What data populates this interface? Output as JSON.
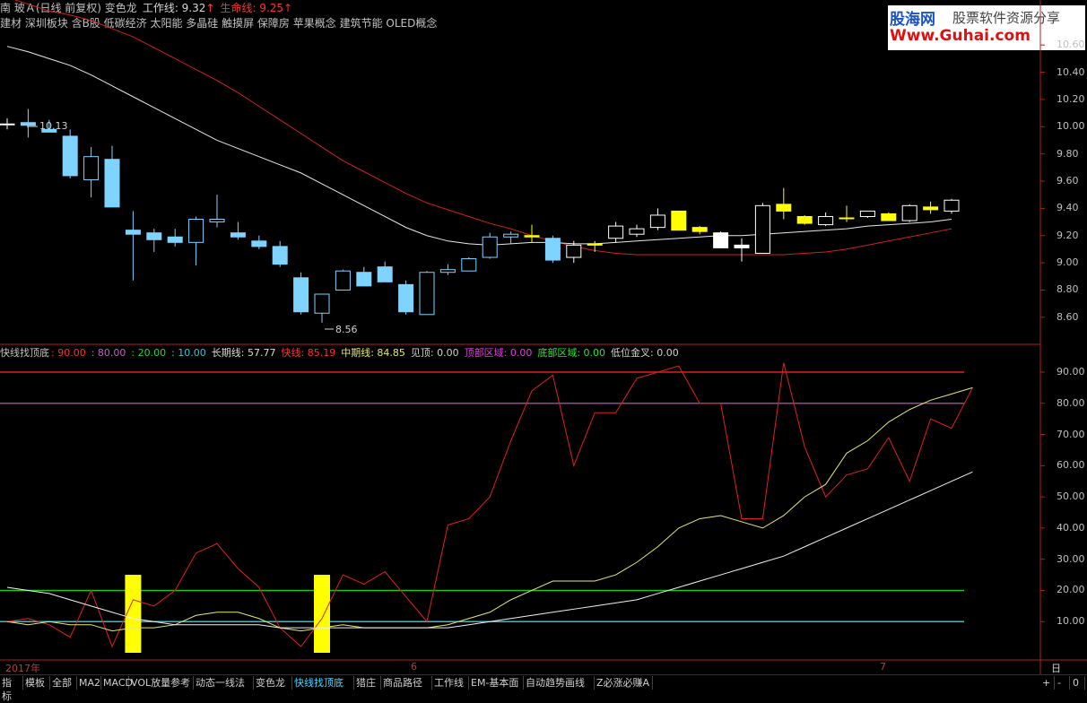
{
  "upper_header": {
    "title": "南 玻Ａ(日线 前复权) 变色龙",
    "work_line_label": "工作线: 9.32",
    "life_line_label": "生命线: 9.25",
    "arrow": "↑",
    "concepts": "建材        深圳板块   含B股 低碳经济 太阳能 多晶硅 触摸屏 保障房 苹果概念 建筑节能 OLED概念"
  },
  "upper_annotations": {
    "high": "10.13",
    "low": "8.56"
  },
  "upper_ticks": [
    "10.60",
    "10.40",
    "10.20",
    "10.00",
    "9.80",
    "9.60",
    "9.40",
    "9.20",
    "9.00",
    "8.80",
    "8.60"
  ],
  "lower_header": {
    "name": "快线找顶底",
    "v1": ": 90.00",
    "v2": ": 80.00",
    "v3": ": 20.00",
    "v4": ": 10.00",
    "long_line": "长期线: 57.77",
    "fast_line": "快线: 85.19",
    "mid_line": "中期线: 84.85",
    "top_see": "见顶: 0.00",
    "top_zone": "顶部区域: 0.00",
    "bottom_zone": "底部区域: 0.00",
    "low_cross": "低位金叉: 0.00"
  },
  "lower_ticks": [
    "90.00",
    "80.00",
    "70.00",
    "60.00",
    "50.00",
    "40.00",
    "30.00",
    "20.00",
    "10.00"
  ],
  "x_axis": {
    "year": "2017年",
    "m6": "6",
    "m7": "7",
    "period": "日线"
  },
  "tabs": [
    "指标",
    "模板",
    "全部",
    "MA2",
    "MACD",
    "VOL放量参考",
    "动态一线法",
    "变色龙",
    "快线找顶底",
    "猎庄",
    "商品路径",
    "工作线",
    "EM-基本面",
    "自动趋势画线",
    "Z必涨必赚A"
  ],
  "active_tab": "快线找顶底",
  "corner": {
    "plus": "+",
    "minus": "-",
    "zero": "0"
  },
  "watermark": {
    "site": "股海网",
    "slogan": "股票软件资源分享",
    "url": "Www.Guhai.com"
  },
  "colors": {
    "up": "#ff4040",
    "down": "#7fd3ff",
    "yellow": "#ffff00",
    "white": "#ffffff",
    "red": "#e02020"
  },
  "chart_data": [
    {
      "type": "candlestick",
      "ylim": [
        8.5,
        10.7
      ],
      "candles": [
        {
          "o": 10.02,
          "h": 10.06,
          "l": 9.98,
          "c": 10.02,
          "color": "cross"
        },
        {
          "o": 10.03,
          "h": 10.13,
          "l": 9.92,
          "c": 10.01,
          "color": "down"
        },
        {
          "o": 9.98,
          "h": 10.05,
          "l": 9.96,
          "c": 9.96,
          "color": "down"
        },
        {
          "o": 9.93,
          "h": 9.98,
          "l": 9.62,
          "c": 9.64,
          "color": "down"
        },
        {
          "o": 9.61,
          "h": 9.85,
          "l": 9.48,
          "c": 9.78,
          "color": "up"
        },
        {
          "o": 9.76,
          "h": 9.86,
          "l": 9.41,
          "c": 9.41,
          "color": "down"
        },
        {
          "o": 9.24,
          "h": 9.38,
          "l": 8.87,
          "c": 9.21,
          "color": "down"
        },
        {
          "o": 9.22,
          "h": 9.25,
          "l": 9.08,
          "c": 9.17,
          "color": "down"
        },
        {
          "o": 9.19,
          "h": 9.25,
          "l": 9.12,
          "c": 9.15,
          "color": "down"
        },
        {
          "o": 9.15,
          "h": 9.34,
          "l": 8.98,
          "c": 9.32,
          "color": "up"
        },
        {
          "o": 9.3,
          "h": 9.5,
          "l": 9.26,
          "c": 9.32,
          "color": "up"
        },
        {
          "o": 9.22,
          "h": 9.3,
          "l": 9.17,
          "c": 9.19,
          "color": "down"
        },
        {
          "o": 9.16,
          "h": 9.2,
          "l": 9.1,
          "c": 9.12,
          "color": "down"
        },
        {
          "o": 9.12,
          "h": 9.16,
          "l": 8.97,
          "c": 8.99,
          "color": "down"
        },
        {
          "o": 8.89,
          "h": 8.93,
          "l": 8.62,
          "c": 8.64,
          "color": "down"
        },
        {
          "o": 8.63,
          "h": 8.77,
          "l": 8.56,
          "c": 8.77,
          "color": "up"
        },
        {
          "o": 8.8,
          "h": 8.95,
          "l": 8.8,
          "c": 8.94,
          "color": "up"
        },
        {
          "o": 8.93,
          "h": 8.97,
          "l": 8.84,
          "c": 8.83,
          "color": "down"
        },
        {
          "o": 8.97,
          "h": 9.01,
          "l": 8.86,
          "c": 8.86,
          "color": "down"
        },
        {
          "o": 8.84,
          "h": 8.87,
          "l": 8.62,
          "c": 8.64,
          "color": "down"
        },
        {
          "o": 8.62,
          "h": 8.94,
          "l": 8.62,
          "c": 8.93,
          "color": "up"
        },
        {
          "o": 8.93,
          "h": 8.99,
          "l": 8.91,
          "c": 8.95,
          "color": "up"
        },
        {
          "o": 8.94,
          "h": 9.04,
          "l": 8.94,
          "c": 9.03,
          "color": "up"
        },
        {
          "o": 9.04,
          "h": 9.22,
          "l": 9.03,
          "c": 9.19,
          "color": "up"
        },
        {
          "o": 9.19,
          "h": 9.23,
          "l": 9.14,
          "c": 9.21,
          "color": "up"
        },
        {
          "o": 9.2,
          "h": 9.28,
          "l": 9.15,
          "c": 9.19,
          "color": "cross-y"
        },
        {
          "o": 9.18,
          "h": 9.2,
          "l": 9.0,
          "c": 9.02,
          "color": "down"
        },
        {
          "o": 9.04,
          "h": 9.16,
          "l": 9.0,
          "c": 9.13,
          "color": "up-y"
        },
        {
          "o": 9.13,
          "h": 9.16,
          "l": 9.08,
          "c": 9.14,
          "color": "cross-y"
        },
        {
          "o": 9.18,
          "h": 9.3,
          "l": 9.15,
          "c": 9.27,
          "color": "up-y"
        },
        {
          "o": 9.21,
          "h": 9.28,
          "l": 9.19,
          "c": 9.25,
          "color": "up-y"
        },
        {
          "o": 9.26,
          "h": 9.4,
          "l": 9.24,
          "c": 9.35,
          "color": "up-y"
        },
        {
          "o": 9.38,
          "h": 9.38,
          "l": 9.24,
          "c": 9.24,
          "color": "down-y"
        },
        {
          "o": 9.26,
          "h": 9.27,
          "l": 9.21,
          "c": 9.23,
          "color": "down-y"
        },
        {
          "o": 9.22,
          "h": 9.23,
          "l": 9.11,
          "c": 9.11,
          "color": "down-w"
        },
        {
          "o": 9.13,
          "h": 9.18,
          "l": 9.01,
          "c": 9.11,
          "color": "cross-w"
        },
        {
          "o": 9.07,
          "h": 9.44,
          "l": 9.07,
          "c": 9.42,
          "color": "up-y"
        },
        {
          "o": 9.43,
          "h": 9.55,
          "l": 9.32,
          "c": 9.38,
          "color": "down-y"
        },
        {
          "o": 9.34,
          "h": 9.35,
          "l": 9.28,
          "c": 9.29,
          "color": "down-y"
        },
        {
          "o": 9.28,
          "h": 9.37,
          "l": 9.27,
          "c": 9.34,
          "color": "up-y"
        },
        {
          "o": 9.33,
          "h": 9.42,
          "l": 9.3,
          "c": 9.33,
          "color": "cross-y"
        },
        {
          "o": 9.34,
          "h": 9.38,
          "l": 9.33,
          "c": 9.38,
          "color": "up-y"
        },
        {
          "o": 9.36,
          "h": 9.37,
          "l": 9.31,
          "c": 9.31,
          "color": "down-y"
        },
        {
          "o": 9.31,
          "h": 9.43,
          "l": 9.3,
          "c": 9.42,
          "color": "up-y"
        },
        {
          "o": 9.39,
          "h": 9.45,
          "l": 9.36,
          "c": 9.41,
          "color": "cross-y"
        },
        {
          "o": 9.38,
          "h": 9.47,
          "l": 9.36,
          "c": 9.46,
          "color": "up-y"
        }
      ],
      "white_line": [
        10.59,
        10.55,
        10.5,
        10.45,
        10.38,
        10.3,
        10.22,
        10.14,
        10.06,
        9.98,
        9.9,
        9.84,
        9.78,
        9.72,
        9.66,
        9.58,
        9.5,
        9.42,
        9.34,
        9.26,
        9.2,
        9.16,
        9.14,
        9.13,
        9.14,
        9.15,
        9.15,
        9.14,
        9.14,
        9.15,
        9.16,
        9.17,
        9.18,
        9.19,
        9.2,
        9.2,
        9.21,
        9.22,
        9.23,
        9.24,
        9.25,
        9.27,
        9.28,
        9.29,
        9.3,
        9.32
      ],
      "red_line": [
        10.95,
        10.9,
        10.85,
        10.82,
        10.78,
        10.72,
        10.66,
        10.58,
        10.5,
        10.42,
        10.34,
        10.25,
        10.15,
        10.05,
        9.95,
        9.85,
        9.75,
        9.67,
        9.59,
        9.51,
        9.44,
        9.39,
        9.34,
        9.29,
        9.25,
        9.2,
        9.16,
        9.12,
        9.09,
        9.07,
        9.06,
        9.06,
        9.06,
        9.06,
        9.06,
        9.06,
        9.06,
        9.06,
        9.07,
        9.08,
        9.1,
        9.13,
        9.16,
        9.19,
        9.22,
        9.25
      ]
    },
    {
      "type": "line",
      "ylim": [
        0,
        95
      ],
      "hlines": [
        90,
        80,
        20,
        10
      ],
      "series": [
        {
          "name": "快线",
          "color": "red",
          "values": [
            10,
            11,
            9,
            5,
            20,
            2,
            17,
            15,
            20,
            32,
            35,
            27,
            21,
            8,
            2,
            11,
            25,
            22,
            26,
            18,
            10,
            41,
            43,
            50,
            68,
            84,
            89,
            60,
            77,
            77,
            88,
            90,
            92,
            80,
            80,
            43,
            43,
            93,
            66,
            50,
            57,
            59,
            69,
            55,
            75,
            72,
            85
          ]
        },
        {
          "name": "中期线",
          "color": "yellow",
          "values": [
            10,
            9,
            10,
            9,
            9,
            7,
            8,
            8,
            9,
            12,
            13,
            13,
            11,
            8,
            7,
            8,
            9,
            8,
            8,
            8,
            8,
            9,
            11,
            13,
            17,
            20,
            23,
            23,
            23,
            25,
            29,
            34,
            40,
            43,
            44,
            42,
            40,
            44,
            50,
            54,
            64,
            68,
            74,
            78,
            81,
            83,
            85
          ]
        },
        {
          "name": "长期线",
          "color": "white",
          "values": [
            21,
            20,
            19,
            17,
            15,
            13,
            11,
            10,
            9,
            9,
            9,
            9,
            9,
            8,
            8,
            8,
            8,
            8,
            8,
            8,
            8,
            8,
            9,
            10,
            11,
            12,
            13,
            14,
            15,
            16,
            17,
            19,
            21,
            23,
            25,
            27,
            29,
            31,
            34,
            37,
            40,
            43,
            46,
            49,
            52,
            55,
            58
          ]
        }
      ],
      "signals": [
        6,
        15
      ]
    }
  ]
}
